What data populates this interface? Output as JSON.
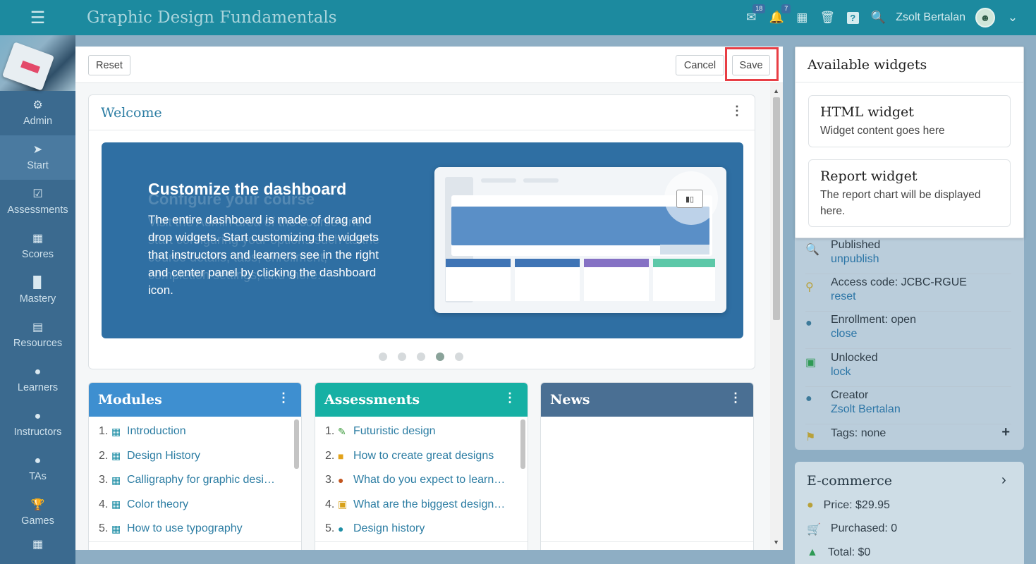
{
  "header": {
    "title": "Graphic Design Fundamentals",
    "messages_count": "18",
    "notifications_count": "7",
    "user_name": "Zsolt Bertalan"
  },
  "sidebar": {
    "items": [
      {
        "label": "Admin",
        "icon": "gear-icon"
      },
      {
        "label": "Start",
        "icon": "navigation-arrow-icon",
        "active": true
      },
      {
        "label": "Assessments",
        "icon": "checkbox-icon"
      },
      {
        "label": "Scores",
        "icon": "table-icon"
      },
      {
        "label": "Mastery",
        "icon": "bar-chart-icon"
      },
      {
        "label": "Resources",
        "icon": "books-icon"
      },
      {
        "label": "Learners",
        "icon": "user-icon"
      },
      {
        "label": "Instructors",
        "icon": "instructor-icon"
      },
      {
        "label": "TAs",
        "icon": "ta-icon"
      },
      {
        "label": "Games",
        "icon": "trophy-icon"
      }
    ]
  },
  "toolbar": {
    "reset_label": "Reset",
    "cancel_label": "Cancel",
    "save_label": "Save"
  },
  "welcome": {
    "title": "Welcome",
    "slide_title": "Customize the dashboard",
    "slide_text": "The entire dashboard is made of drag and drop widgets. Start customizing the widgets that instructors and learners see in the right and center panel by clicking the dashboard icon.",
    "ghost_title": "Configure your course",
    "ghost_text": "Visit the Admin area of the course and start configuring your options such as the course details, tabs, enrollment, completion settings, and more.",
    "active_slide": 4,
    "slide_count": 5
  },
  "modules": {
    "title": "Modules",
    "color": "#3e8fd0",
    "items": [
      {
        "num": "1.",
        "label": "Introduction"
      },
      {
        "num": "2.",
        "label": "Design History"
      },
      {
        "num": "3.",
        "label": "Calligraphy for graphic designers"
      },
      {
        "num": "4.",
        "label": "Color theory"
      },
      {
        "num": "5.",
        "label": "How to use typography"
      }
    ]
  },
  "assessments": {
    "title": "Assessments",
    "color": "#16b0a4",
    "items": [
      {
        "num": "1.",
        "label": "Futuristic design",
        "icon": "pencil-icon"
      },
      {
        "num": "2.",
        "label": "How to create great designs",
        "icon": "cube-icon"
      },
      {
        "num": "3.",
        "label": "What do you expect to learn from this course",
        "icon": "pie-chart-icon"
      },
      {
        "num": "4.",
        "label": "What are the biggest design challenges",
        "icon": "chat-icon"
      },
      {
        "num": "5.",
        "label": "Design history",
        "icon": "group-icon"
      }
    ]
  },
  "news": {
    "title": "News",
    "color": "#4a6f93"
  },
  "available_widgets": {
    "title": "Available widgets",
    "items": [
      {
        "title": "HTML widget",
        "desc": "Widget content goes here"
      },
      {
        "title": "Report widget",
        "desc": "The report chart will be displayed here."
      }
    ]
  },
  "course_props": {
    "published": "Published",
    "unpublish": "unpublish",
    "access_code": "Access code: JCBC-RGUE",
    "reset": "reset",
    "enrollment": "Enrollment: open",
    "close": "close",
    "unlocked": "Unlocked",
    "lock": "lock",
    "creator": "Creator",
    "creator_name": "Zsolt Bertalan",
    "tags": "Tags: none"
  },
  "ecommerce": {
    "title": "E-commerce",
    "price": "Price: $29.95",
    "purchased": "Purchased: 0",
    "total": "Total: $0"
  }
}
